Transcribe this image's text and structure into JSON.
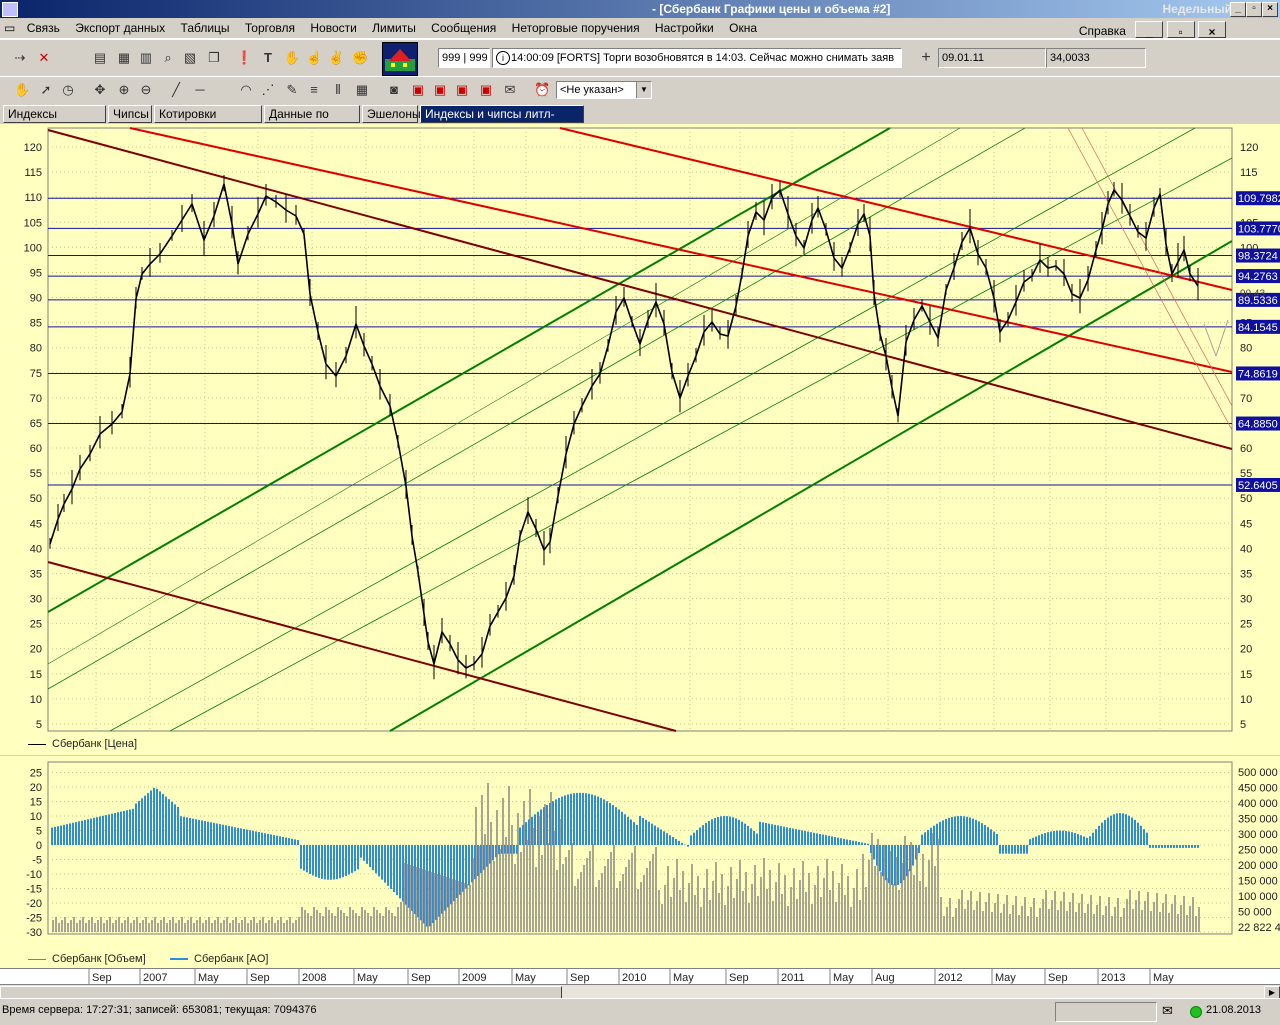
{
  "window": {
    "title": "- [Сбербанк Графики цены и объема #2]",
    "right_label": "Недельный"
  },
  "menu": {
    "items": [
      "Связь",
      "Экспорт данных",
      "Таблицы",
      "Торговля",
      "Новости",
      "Лимиты",
      "Сообщения",
      "Неторговые поручения",
      "Настройки",
      "Окна"
    ],
    "help": "Справка"
  },
  "toolbar": {
    "counter": "999 | 999",
    "message": "14:00:09  [FORTS] Торги возобновятся в 14:03. Сейчас можно снимать заяв",
    "date": "09.01.11",
    "value": "34,0033",
    "select": "<Не указан>"
  },
  "tabs": [
    {
      "label": "Индексы дневные",
      "active": false
    },
    {
      "label": "Чипсы",
      "active": false
    },
    {
      "label": "Котировки таблица",
      "active": false
    },
    {
      "label": "Данные по счету",
      "active": false
    },
    {
      "label": "Эшелоны",
      "active": false
    },
    {
      "label": "Индексы и чипсы литл-фрейм",
      "active": true
    }
  ],
  "price_chart": {
    "legend": "Сбербанк [Цена]",
    "y_ticks": [
      120,
      115,
      110,
      105,
      100,
      95,
      90,
      85,
      80,
      75,
      70,
      65,
      60,
      55,
      50,
      45,
      40,
      35,
      30,
      25,
      20,
      15,
      10,
      5
    ],
    "levels": [
      {
        "value": 109.7982,
        "label": "109.7982"
      },
      {
        "value": 103.777,
        "label": "103.7770"
      },
      {
        "value": 98.3724,
        "label": "98.3724"
      },
      {
        "value": 94.2763,
        "label": "94.2763"
      },
      {
        "value": 89.5336,
        "label": "89.5336"
      },
      {
        "value": 84.1545,
        "label": "84.1545"
      },
      {
        "value": 74.8619,
        "label": "74.8619"
      },
      {
        "value": 64.885,
        "label": "64.8850"
      },
      {
        "value": 52.6405,
        "label": "52.6405"
      }
    ],
    "last_price_label": "90.43"
  },
  "volume_chart": {
    "legend_volume": "Сбербанк [Объем]",
    "legend_ao": "Сбербанк [AO]",
    "y_left": [
      "25",
      "20",
      "15",
      "10",
      "5",
      "0",
      "-5",
      "-10",
      "-15",
      "-20",
      "-25",
      "-30"
    ],
    "y_right": [
      "500 000",
      "450 000",
      "400 000",
      "350 000",
      "300 000",
      "250 000",
      "200 000",
      "150 000",
      "100 000",
      "50 000",
      "22 822 4"
    ]
  },
  "time_axis": [
    "Sep",
    "2007",
    "May",
    "Sep",
    "2008",
    "May",
    "Sep",
    "2009",
    "May",
    "Sep",
    "2010",
    "May",
    "Sep",
    "2011",
    "May",
    "Aug",
    "2012",
    "May",
    "Sep",
    "2013",
    "May"
  ],
  "status": {
    "left": "Время сервера: 17:27:31; записей: 653081; текущая: 7094376",
    "date": "21.08.2013"
  },
  "colors": {
    "chart_bg": "#ffffc0",
    "horizontal_level": "#1010a0",
    "green_channel": "#008000",
    "red_channel": "#e00000",
    "darkred_channel": "#800000",
    "ao_bar": "#2a8de0",
    "volume_bar": "#808080"
  }
}
